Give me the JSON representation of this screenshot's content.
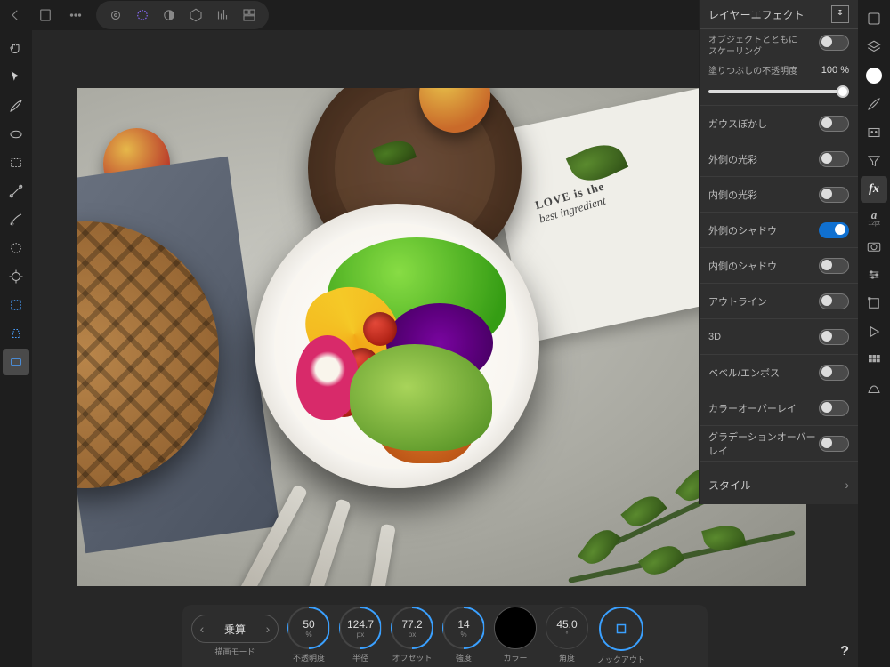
{
  "topbar": {
    "personas": [
      "photo",
      "liquify",
      "develop",
      "tonemap",
      "macros",
      "export"
    ]
  },
  "fx_panel": {
    "title": "レイヤーエフェクト",
    "scale_label": "オブジェクトとともに\nスケーリング",
    "fill_opacity_label": "塗りつぶしの不透明度",
    "fill_opacity_value": "100 %",
    "effects": [
      {
        "label": "ガウスぼかし",
        "on": false
      },
      {
        "label": "外側の光彩",
        "on": false
      },
      {
        "label": "内側の光彩",
        "on": false
      },
      {
        "label": "外側のシャドウ",
        "on": true
      },
      {
        "label": "内側のシャドウ",
        "on": false
      },
      {
        "label": "アウトライン",
        "on": false
      },
      {
        "label": "3D",
        "on": false
      },
      {
        "label": "ベベル/エンボス",
        "on": false
      },
      {
        "label": "カラーオーバーレイ",
        "on": false
      },
      {
        "label": "グラデーションオーバーレイ",
        "on": false
      }
    ],
    "styles_label": "スタイル"
  },
  "context": {
    "blend_label": "描画モード",
    "blend_value": "乗算",
    "params": [
      {
        "value": "50",
        "unit": "%",
        "label": "不透明度",
        "arc": true
      },
      {
        "value": "124.7",
        "unit": "px",
        "label": "半径",
        "arc": true
      },
      {
        "value": "77.2",
        "unit": "px",
        "label": "オフセット",
        "arc": true
      },
      {
        "value": "14",
        "unit": "%",
        "label": "強度",
        "arc": true
      },
      {
        "color": "#000",
        "label": "カラー"
      },
      {
        "value": "45.0",
        "unit": "°",
        "label": "角度",
        "arc": false
      },
      {
        "knockout": true,
        "label": "ノックアウト"
      }
    ]
  },
  "napkin": {
    "line1": "LOVE is the",
    "line2": "best ingredient"
  },
  "right_text": {
    "char": "a",
    "size": "12pt"
  }
}
